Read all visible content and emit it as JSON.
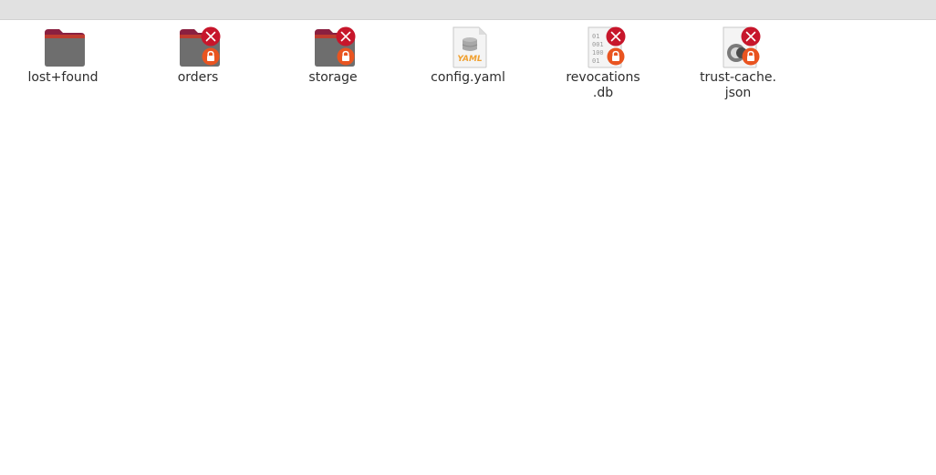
{
  "files": [
    {
      "name": "lost+found",
      "icon": "folder-icon",
      "emblems": []
    },
    {
      "name": "orders",
      "icon": "folder-icon",
      "emblems": [
        "unreadable-emblem-icon",
        "lock-emblem-icon"
      ]
    },
    {
      "name": "storage",
      "icon": "folder-icon",
      "emblems": [
        "unreadable-emblem-icon",
        "lock-emblem-icon"
      ]
    },
    {
      "name": "config.yaml",
      "icon": "yaml-file-icon",
      "emblems": []
    },
    {
      "name": "revocations\n.db",
      "icon": "database-file-icon",
      "emblems": [
        "unreadable-emblem-icon",
        "lock-emblem-icon"
      ]
    },
    {
      "name": "trust-cache.\njson",
      "icon": "json-file-icon",
      "emblems": [
        "unreadable-emblem-icon",
        "lock-emblem-icon"
      ]
    }
  ],
  "colors": {
    "folder_back": "#8a2040",
    "folder_front": "#6e6e6e",
    "emblem_unreadable": "#c7162b",
    "emblem_lock": "#e95420",
    "yaml_text": "#f0a030"
  }
}
